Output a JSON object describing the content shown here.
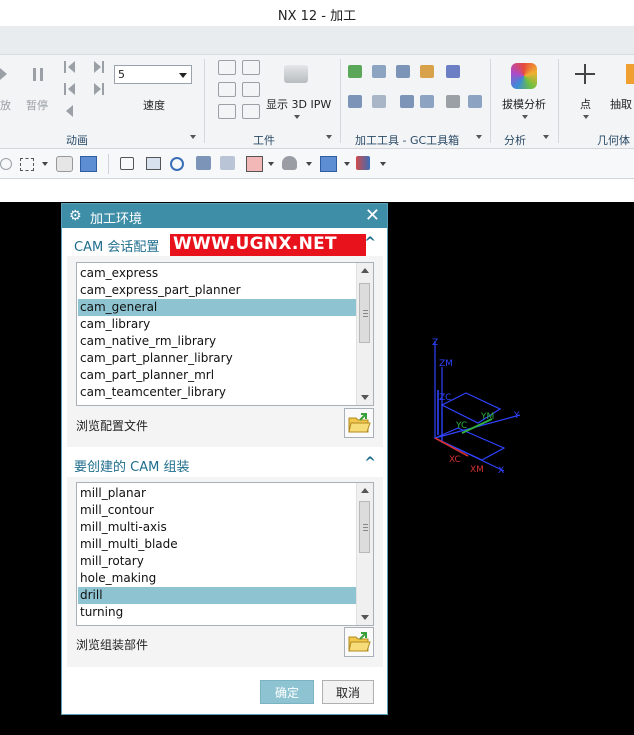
{
  "window": {
    "title": "NX 12 - 加工"
  },
  "ribbon": {
    "animation": {
      "play_label": "放",
      "pause_label": "暂停",
      "speed_value": "5",
      "speed_label": "速度",
      "group_label": "动画"
    },
    "workpiece": {
      "show_ipw_label": "显示 3D IPW",
      "group_label": "工件"
    },
    "machining_tools": {
      "group_label": "加工工具 - GC工具箱"
    },
    "analysis": {
      "draft_label": "拔模分析",
      "group_label": "分析"
    },
    "geometry": {
      "point_label": "点",
      "extract_label": "抽取",
      "group_label": "几何体"
    }
  },
  "dialog": {
    "title": "加工环境",
    "close": "✕",
    "session_section": {
      "label": "CAM 会话配置",
      "items": [
        "cam_express",
        "cam_express_part_planner",
        "cam_general",
        "cam_library",
        "cam_native_rm_library",
        "cam_part_planner_library",
        "cam_part_planner_mrl",
        "cam_teamcenter_library"
      ],
      "selected": "cam_general",
      "browse_label": "浏览配置文件"
    },
    "setup_section": {
      "label": "要创建的 CAM 组装",
      "items": [
        "mill_planar",
        "mill_contour",
        "mill_multi-axis",
        "mill_multi_blade",
        "mill_rotary",
        "hole_making",
        "drill",
        "turning"
      ],
      "selected": "drill",
      "browse_label": "浏览组装部件"
    },
    "ok_label": "确定",
    "cancel_label": "取消"
  },
  "watermark": {
    "text": "WWW.UGNX.NET"
  },
  "axes": {
    "labels": [
      "Z",
      "ZM",
      "ZC",
      "YM",
      "Y",
      "YC",
      "XC",
      "XM",
      "X"
    ]
  },
  "colors": {
    "title_bar": "#3f8ea8",
    "selection": "#8ec4d2",
    "accent_text": "#1f6d8c",
    "watermark": "#e8121c"
  }
}
